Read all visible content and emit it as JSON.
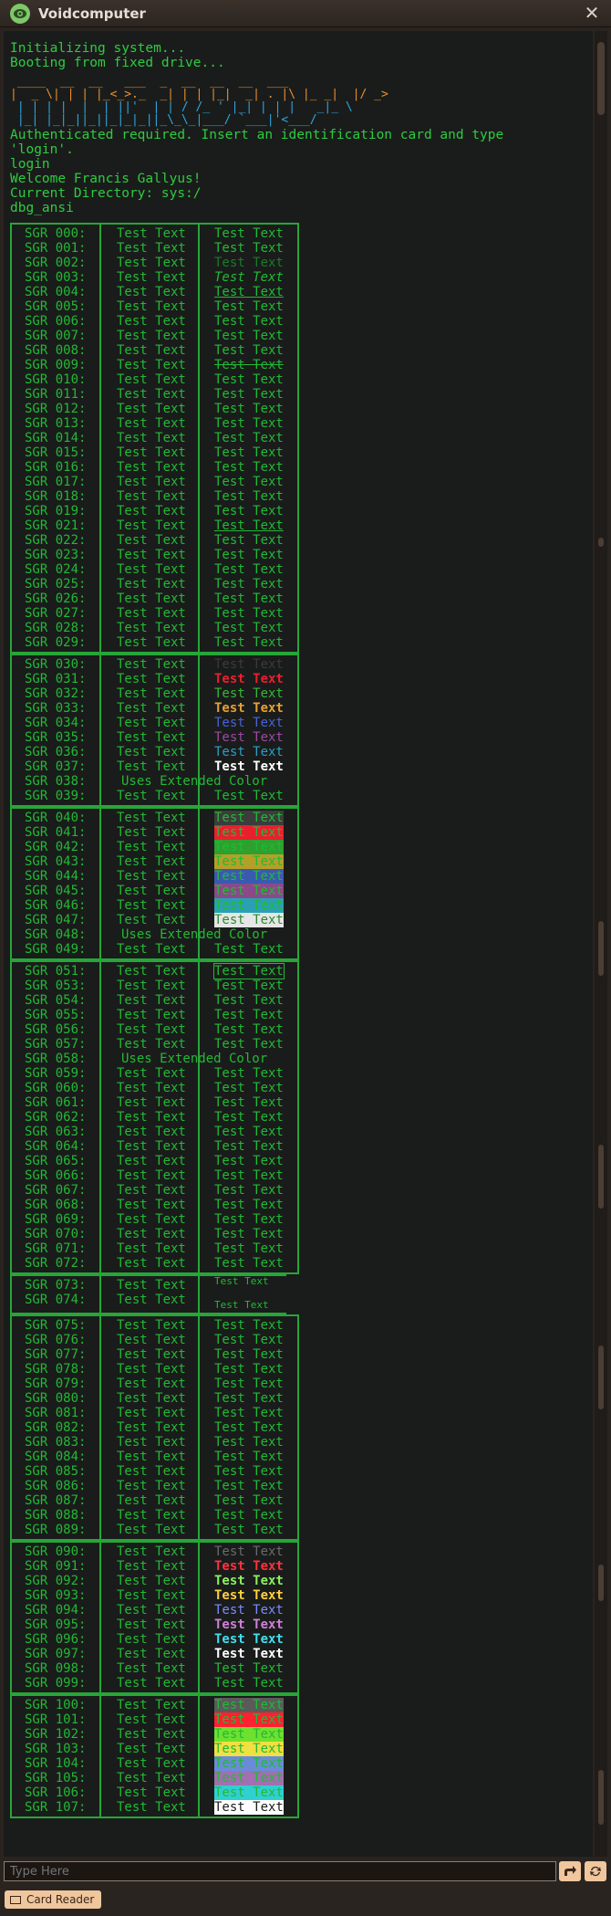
{
  "window": {
    "title": "Voidcomputer",
    "close_label": "✕"
  },
  "boot_lines": [
    "Initializing system...",
    "Booting from fixed drive..."
  ],
  "logo_art": [
    " ____  __  __   ___  _  __  __  __  ___",
    "|  _ \\| | | |_<_>._  _| | | |_|  _| . |\\ |_ _|  |/ _>",
    " | | | |  |  | ||'  | | / /_ ' |_| | | |   _|_ \\",
    " |_| |_|_||_||_|_|_||_\\_\\_|___/ `___|'<___/"
  ],
  "post_lines": [
    "Authenticated required. Insert an identification card and type",
    "'login'.",
    "login",
    "Welcome Francis Gallyus!",
    "Current Directory: sys:/",
    "dbg_ansi"
  ],
  "sgr_prefix": "SGR",
  "sample_text": "Test Text",
  "extended_label": "Uses Extended Color",
  "sgr_codes": [
    "000",
    "001",
    "002",
    "003",
    "004",
    "005",
    "006",
    "007",
    "008",
    "009",
    "010",
    "011",
    "012",
    "013",
    "014",
    "015",
    "016",
    "017",
    "018",
    "019",
    "021",
    "022",
    "023",
    "024",
    "025",
    "026",
    "027",
    "028",
    "029",
    "030",
    "031",
    "032",
    "033",
    "034",
    "035",
    "036",
    "037",
    "038",
    "039",
    "040",
    "041",
    "042",
    "043",
    "044",
    "045",
    "046",
    "047",
    "048",
    "049",
    "051",
    "053",
    "054",
    "055",
    "056",
    "057",
    "058",
    "059",
    "060",
    "061",
    "062",
    "063",
    "064",
    "065",
    "066",
    "067",
    "068",
    "069",
    "070",
    "071",
    "072",
    "073",
    "074",
    "075",
    "076",
    "077",
    "078",
    "079",
    "080",
    "081",
    "082",
    "083",
    "084",
    "085",
    "086",
    "087",
    "088",
    "089",
    "090",
    "091",
    "092",
    "093",
    "094",
    "095",
    "096",
    "097",
    "098",
    "099",
    "100",
    "101",
    "102",
    "103",
    "104",
    "105",
    "106",
    "107"
  ],
  "colors": {
    "term_green": "#22b935",
    "fg_black": "#3a3a3a",
    "fg_red": "#e8202e",
    "fg_green": "#36b936",
    "fg_yellow": "#e6a035",
    "fg_blue": "#4a62d6",
    "fg_magenta": "#9a4aa0",
    "fg_cyan": "#2aa0c8",
    "fg_white": "#ffffff",
    "bg_black": "#3c3c3c",
    "bg_red": "#e8202e",
    "bg_green": "#2ea02e",
    "bg_yellow": "#b4a028",
    "bg_blue": "#3a5ab0",
    "bg_magenta": "#8a4a8a",
    "bg_cyan": "#2aa0b4",
    "bg_white": "#e6e6e6"
  },
  "input": {
    "placeholder": "Type Here"
  },
  "buttons": {
    "send_icon": "send-icon",
    "refresh_icon": "refresh-icon",
    "card_reader": "Card Reader"
  }
}
